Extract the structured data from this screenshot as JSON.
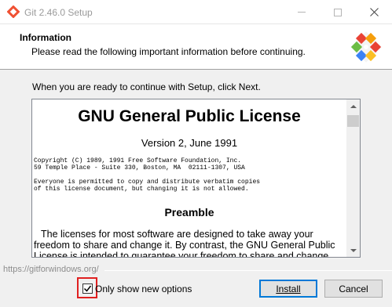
{
  "window": {
    "title": "Git 2.46.0 Setup",
    "icon": "git-logo-icon",
    "controls": [
      "minimize-icon",
      "maximize-icon",
      "close-icon"
    ]
  },
  "header": {
    "title": "Information",
    "subtitle": "Please read the following important information before continuing.",
    "logo": "git-logo"
  },
  "intro": "When you are ready to continue with Setup, click Next.",
  "license": {
    "title": "GNU General Public License",
    "version": "Version 2, June 1991",
    "copyright_line1": "Copyright (C) 1989, 1991 Free Software Foundation, Inc.",
    "copyright_line2": "59 Temple Place - Suite 330, Boston, MA  02111-1307, USA",
    "permission_line1": "Everyone is permitted to copy and distribute verbatim copies",
    "permission_line2": "of this license document, but changing it is not allowed.",
    "preamble_heading": "Preamble",
    "preamble_line1": "The licenses for most software are designed to take away your",
    "preamble_line2": "freedom to share and change it. By contrast, the GNU General Public",
    "preamble_line3": "License is intended to guarantee your freedom to share and change"
  },
  "footer": {
    "url": "https://gitforwindows.org/",
    "only_new_options_label": "Only show new options",
    "only_new_options_checked": true,
    "install_label": "Install",
    "cancel_label": "Cancel"
  },
  "colors": {
    "focus_border": "#0078d7",
    "highlight": "#e02020"
  }
}
